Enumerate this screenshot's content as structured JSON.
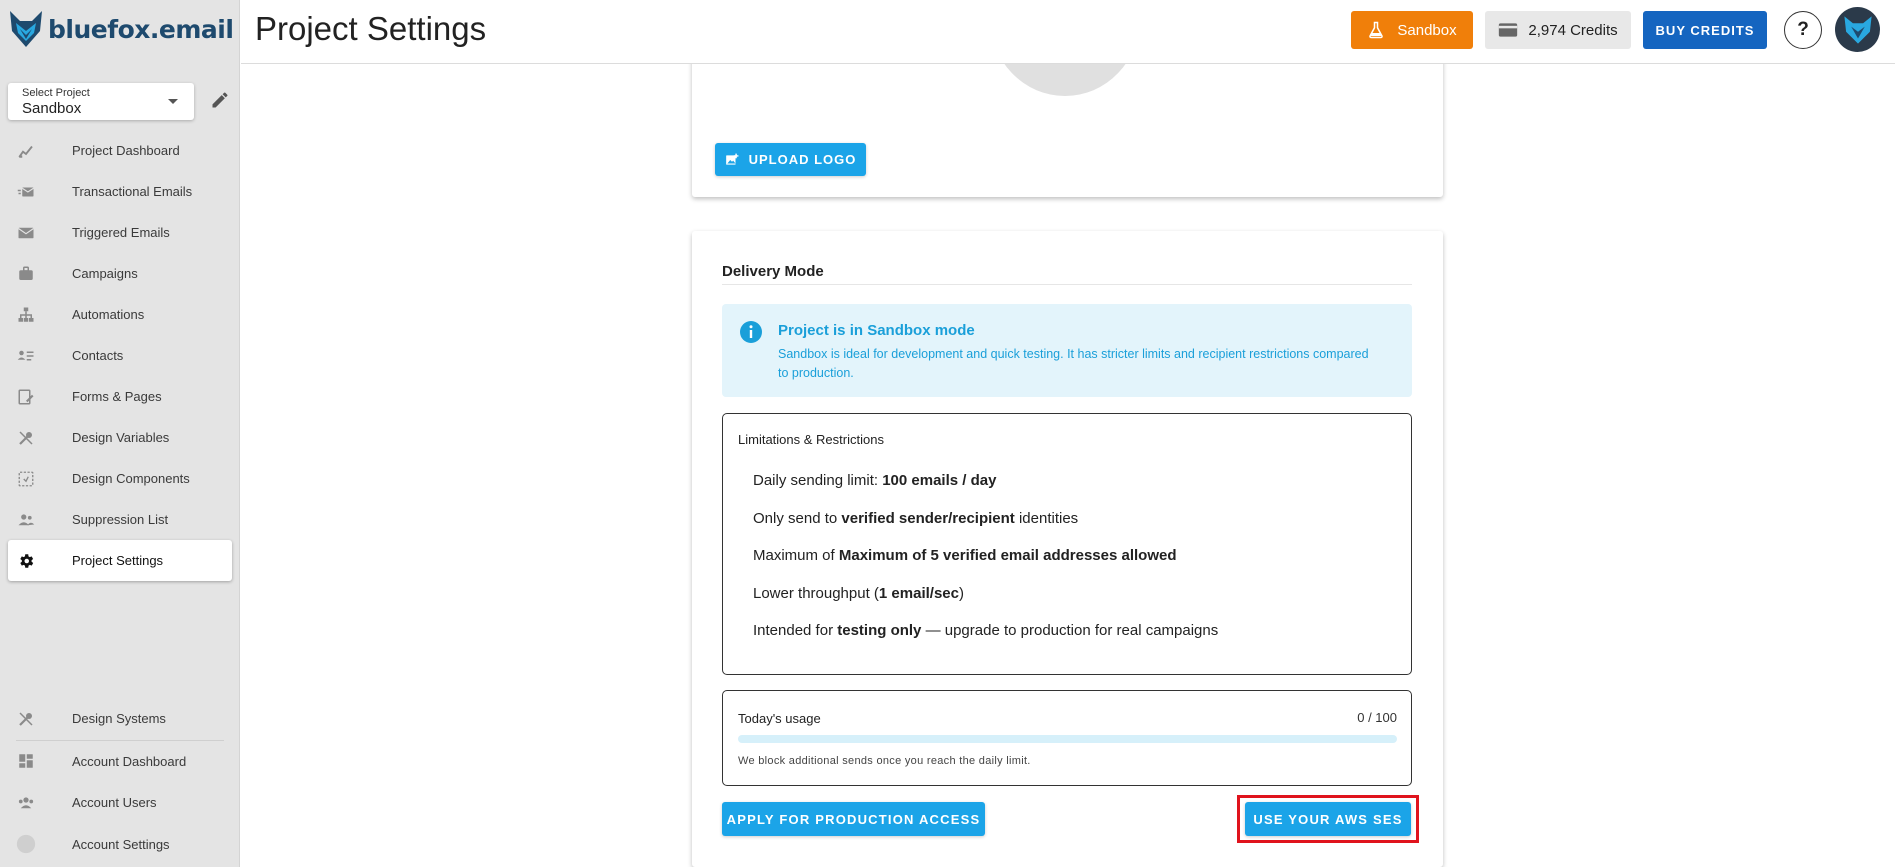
{
  "brand": {
    "logo_text": "bluefox.email",
    "accent": "#1ba4e8"
  },
  "sidebar": {
    "project_select": {
      "label": "Select Project",
      "value": "Sandbox"
    },
    "items": [
      {
        "label": "Project Dashboard",
        "icon": "chart-icon"
      },
      {
        "label": "Transactional Emails",
        "icon": "email-fast-icon"
      },
      {
        "label": "Triggered Emails",
        "icon": "email-icon"
      },
      {
        "label": "Campaigns",
        "icon": "briefcase-icon"
      },
      {
        "label": "Automations",
        "icon": "sitemap-icon"
      },
      {
        "label": "Contacts",
        "icon": "contacts-icon"
      },
      {
        "label": "Forms & Pages",
        "icon": "form-icon"
      },
      {
        "label": "Design Variables",
        "icon": "tools-icon"
      },
      {
        "label": "Design Components",
        "icon": "component-icon"
      },
      {
        "label": "Suppression List",
        "icon": "users-icon"
      },
      {
        "label": "Project Settings",
        "icon": "gear-icon",
        "active": true
      }
    ],
    "bottom_items": [
      {
        "label": "Design Systems",
        "icon": "tools-icon"
      },
      {
        "label": "Account Dashboard",
        "icon": "dashboard-icon"
      },
      {
        "label": "Account Users",
        "icon": "users-icon"
      },
      {
        "label": "Account Settings",
        "icon": "avatar-circle-icon"
      }
    ]
  },
  "header": {
    "title": "Project Settings",
    "mode_button": "Sandbox",
    "credits": "2,974 Credits",
    "buy_button": "BUY CREDITS",
    "help": "?"
  },
  "logo_card": {
    "upload_button": "UPLOAD LOGO"
  },
  "delivery": {
    "title": "Delivery Mode",
    "info": {
      "title_prefix": "Project is in ",
      "title_mode": "Sandbox mode",
      "description": "Sandbox is ideal for development and quick testing. It has stricter limits and recipient restrictions compared to production."
    },
    "limitations": {
      "title": "Limitations & Restrictions",
      "items": [
        {
          "pre": "Daily sending limit: ",
          "bold": "100 emails / day",
          "post": ""
        },
        {
          "pre": "Only send to ",
          "bold": "verified sender/recipient",
          "post": " identities"
        },
        {
          "pre": "Maximum of ",
          "bold": "Maximum of 5 verified email addresses allowed",
          "post": ""
        },
        {
          "pre": "Lower throughput (",
          "bold": "1 email/sec",
          "post": ")"
        },
        {
          "pre": "Intended for ",
          "bold": "testing only",
          "post": " — upgrade to production for real campaigns"
        }
      ]
    },
    "usage": {
      "title": "Today's usage",
      "count": "0 / 100",
      "fraction": 0,
      "note": "We block additional sends once you reach the daily limit."
    },
    "production_button": "APPLY FOR PRODUCTION ACCESS",
    "aws_button": "USE YOUR AWS SES"
  }
}
